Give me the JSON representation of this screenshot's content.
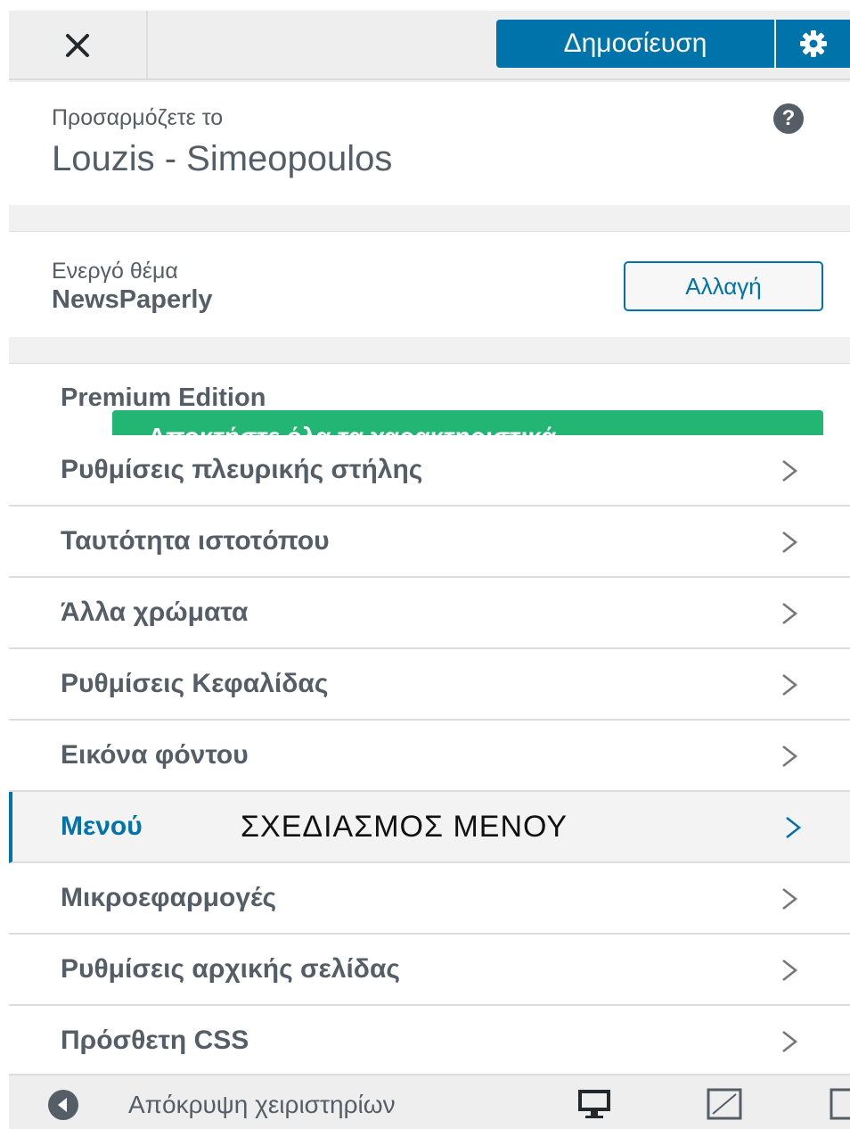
{
  "header": {
    "close_label": "close",
    "publish_label": "Δημοσίευση",
    "settings_icon": "gear-icon"
  },
  "info": {
    "label": "Προσαρμόζετε το",
    "site_title": "Louzis - Simeopoulos",
    "help_icon": "?"
  },
  "theme": {
    "label": "Ενεργό θέμα",
    "name": "NewsPaperly",
    "change_label": "Αλλαγή"
  },
  "premium": {
    "title": "Premium Edition",
    "banner": "Αποκτήστε όλα τα χαρακτηριστικά"
  },
  "menu": {
    "items": [
      {
        "label": "Ρυθμίσεις πλευρικής στήλης"
      },
      {
        "label": "Ταυτότητα ιστοτόπου"
      },
      {
        "label": "Άλλα χρώματα"
      },
      {
        "label": "Ρυθμίσεις Κεφαλίδας"
      },
      {
        "label": "Εικόνα φόντου"
      },
      {
        "label": "Μενού",
        "annotation": "ΣΧΕΔΙΑΣΜΟΣ ΜΕΝΟΥ",
        "active": true
      },
      {
        "label": "Μικροεφαρμογές"
      },
      {
        "label": "Ρυθμίσεις αρχικής σελίδας"
      },
      {
        "label": "Πρόσθετη CSS"
      }
    ]
  },
  "footer": {
    "collapse_label": "Απόκρυψη χειριστηρίων"
  },
  "colors": {
    "accent": "#0073aa",
    "premium_green": "#22b573",
    "panel_bg": "#f1f1f1",
    "text": "#555d66"
  }
}
